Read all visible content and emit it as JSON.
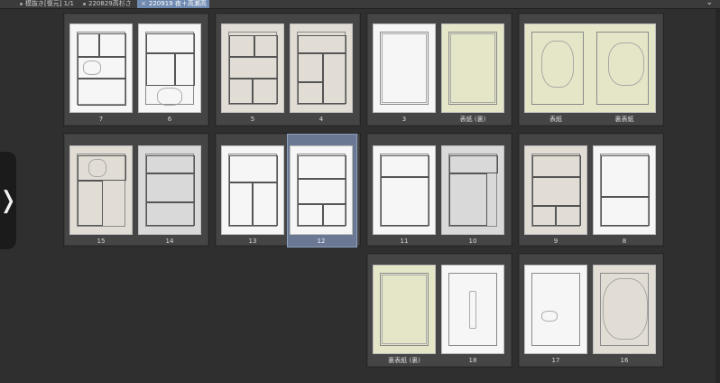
{
  "tabs": [
    {
      "label": "模抜き[復元] 1/1"
    },
    {
      "label": "220829高杉さ"
    },
    {
      "label": "220919 夜＋高瀬高"
    }
  ],
  "pages": {
    "p7": "7",
    "p6": "6",
    "p5": "5",
    "p4": "4",
    "p3": "3",
    "p_cover_back_inner": "表紙 (裏)",
    "p_cover": "表紙",
    "p_back_cover": "裏表紙",
    "p15": "15",
    "p14": "14",
    "p13": "13",
    "p12": "12",
    "p11": "11",
    "p10": "10",
    "p9": "9",
    "p8": "8",
    "p_back_cover_inner": "裏表紙 (裏)",
    "p18": "18",
    "p17": "17",
    "p16": "16"
  },
  "selected_page": "12",
  "colors": {
    "background": "#2f2f2f",
    "tab_active": "#6f8ab0",
    "selection": "#6a7893",
    "cover_paper": "#e5e6c8"
  }
}
